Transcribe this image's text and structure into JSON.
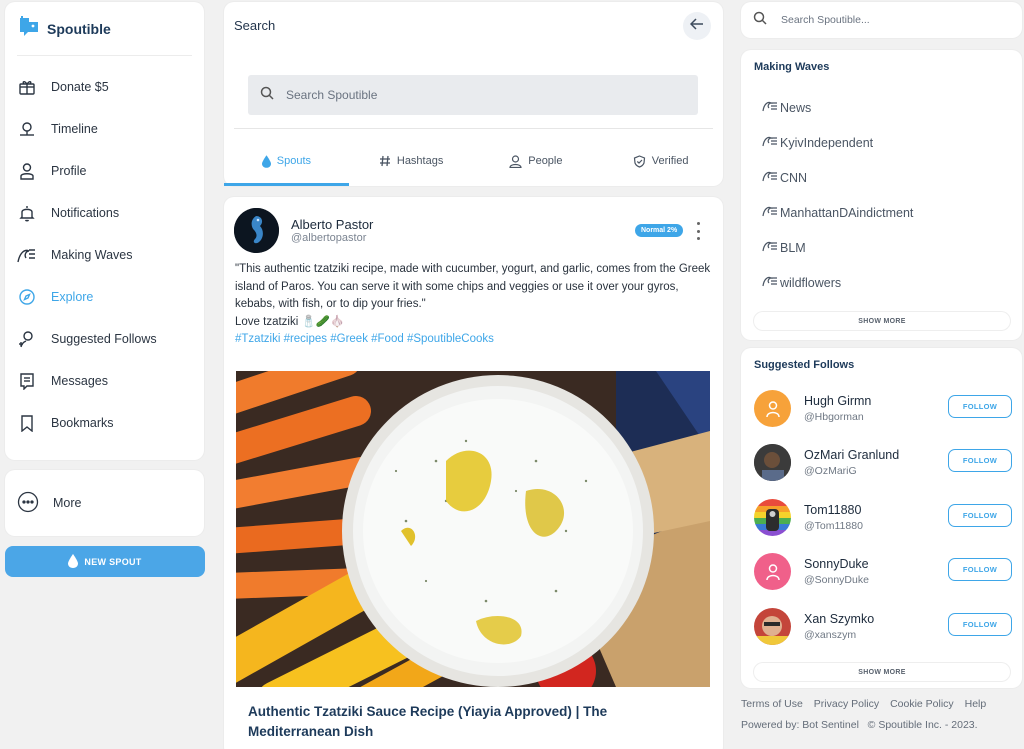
{
  "brand": {
    "name": "Spoutible"
  },
  "nav": {
    "items": [
      {
        "label": "Donate $5",
        "icon": "gift-icon"
      },
      {
        "label": "Timeline",
        "icon": "timeline-icon"
      },
      {
        "label": "Profile",
        "icon": "user-icon"
      },
      {
        "label": "Notifications",
        "icon": "bell-icon"
      },
      {
        "label": "Making Waves",
        "icon": "wave-icon"
      },
      {
        "label": "Explore",
        "icon": "compass-icon"
      },
      {
        "label": "Suggested Follows",
        "icon": "user-plus-icon"
      },
      {
        "label": "Messages",
        "icon": "message-icon"
      },
      {
        "label": "Bookmarks",
        "icon": "bookmark-icon"
      }
    ],
    "more_label": "More",
    "new_spout_label": "NEW SPOUT",
    "accent": "#3ea6e8"
  },
  "search": {
    "title": "Search",
    "placeholder": "Search Spoutible",
    "tabs": [
      {
        "label": "Spouts",
        "icon": "drop-icon",
        "active": true
      },
      {
        "label": "Hashtags",
        "icon": "hash-icon"
      },
      {
        "label": "People",
        "icon": "people-icon"
      },
      {
        "label": "Verified",
        "icon": "verified-icon"
      }
    ]
  },
  "post": {
    "author": "Alberto Pastor",
    "handle": "@albertopastor",
    "badge": "Normal 2%",
    "text": "\"This authentic tzatziki recipe, made with cucumber, yogurt, and garlic, comes from the Greek island of Paros. You can serve it with some chips and veggies or use it over your gyros, kebabs, with fish, or to dip your fries.\"",
    "text2": "Love tzatziki 🧂🥒🧄",
    "hashtags": "#Tzatziki #recipes #Greek #Food #SpoutibleCooks",
    "link_title": "Authentic Tzatziki Sauce Recipe (Yiayia Approved) | The Mediterranean Dish"
  },
  "right": {
    "search_placeholder": "Search Spoutible...",
    "making_waves_title": "Making Waves",
    "waves": [
      "News",
      "KyivIndependent",
      "CNN",
      "ManhattanDAindictment",
      "BLM",
      "wildflowers"
    ],
    "show_more": "SHOW MORE",
    "suggested_title": "Suggested Follows",
    "follows": [
      {
        "name": "Hugh Girmn",
        "handle": "@Hbgorman",
        "color": "#f7a23a"
      },
      {
        "name": "OzMari Granlund",
        "handle": "@OzMariG",
        "color": "#3b3b3b"
      },
      {
        "name": "Tom11880",
        "handle": "@Tom11880",
        "color": "#8a4fd1"
      },
      {
        "name": "SonnyDuke",
        "handle": "@SonnyDuke",
        "color": "#f0608a"
      },
      {
        "name": "Xan Szymko",
        "handle": "@xanszym",
        "color": "#c4453a"
      }
    ],
    "follow_label": "FOLLOW"
  },
  "footer": {
    "links": [
      "Terms of Use",
      "Privacy Policy",
      "Cookie Policy",
      "Help"
    ],
    "powered": "Powered by: Bot Sentinel",
    "copyright": "© Spoutible Inc. - 2023."
  }
}
